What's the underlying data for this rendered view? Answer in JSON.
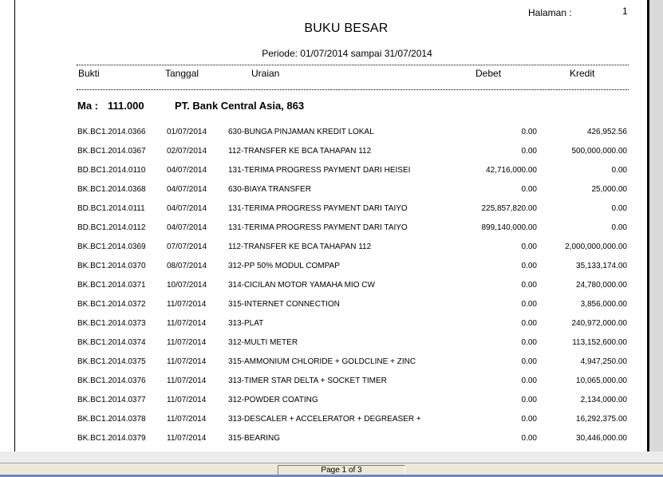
{
  "report": {
    "halaman_label": "Halaman :",
    "halaman_value": "1",
    "title": "BUKU BESAR",
    "periode": "Periode: 01/07/2014 sampai 31/07/2014"
  },
  "columns": {
    "bukti": "Bukti",
    "tanggal": "Tanggal",
    "uraian": "Uraian",
    "debet": "Debet",
    "kredit": "Kredit"
  },
  "account": {
    "prefix": "Ma :",
    "code": "111.000",
    "name": "PT. Bank Central Asia, 863"
  },
  "rows": [
    {
      "bukti": "BK.BC1.2014.0366",
      "tanggal": "01/07/2014",
      "uraian": "630-BUNGA PINJAMAN KREDIT LOKAL",
      "debet": "0.00",
      "kredit": "426,952.56"
    },
    {
      "bukti": "BK.BC1.2014.0367",
      "tanggal": "02/07/2014",
      "uraian": "112-TRANSFER KE BCA TAHAPAN 112",
      "debet": "0.00",
      "kredit": "500,000,000.00"
    },
    {
      "bukti": "BD.BC1.2014.0110",
      "tanggal": "04/07/2014",
      "uraian": "131-TERIMA PROGRESS PAYMENT DARI HEISEI",
      "debet": "42,716,000.00",
      "kredit": "0.00"
    },
    {
      "bukti": "BK.BC1.2014.0368",
      "tanggal": "04/07/2014",
      "uraian": "630-BIAYA TRANSFER",
      "debet": "0.00",
      "kredit": "25,000.00"
    },
    {
      "bukti": "BD.BC1.2014.0111",
      "tanggal": "04/07/2014",
      "uraian": "131-TERIMA PROGRESS PAYMENT DARI TAIYO",
      "debet": "225,857,820.00",
      "kredit": "0.00"
    },
    {
      "bukti": "BD.BC1.2014.0112",
      "tanggal": "04/07/2014",
      "uraian": "131-TERIMA PROGRESS PAYMENT DARI TAIYO",
      "debet": "899,140,000.00",
      "kredit": "0.00"
    },
    {
      "bukti": "BK.BC1.2014.0369",
      "tanggal": "07/07/2014",
      "uraian": "112-TRANSFER KE BCA TAHAPAN 112",
      "debet": "0.00",
      "kredit": "2,000,000,000.00"
    },
    {
      "bukti": "BK.BC1.2014.0370",
      "tanggal": "08/07/2014",
      "uraian": "312-PP 50% MODUL COMPAP",
      "debet": "0.00",
      "kredit": "35,133,174.00"
    },
    {
      "bukti": "BK.BC1.2014.0371",
      "tanggal": "10/07/2014",
      "uraian": "314-CICILAN MOTOR YAMAHA MIO CW",
      "debet": "0.00",
      "kredit": "24,780,000.00"
    },
    {
      "bukti": "BK.BC1.2014.0372",
      "tanggal": "11/07/2014",
      "uraian": "315-INTERNET CONNECTION",
      "debet": "0.00",
      "kredit": "3,856,000.00"
    },
    {
      "bukti": "BK.BC1.2014.0373",
      "tanggal": "11/07/2014",
      "uraian": "313-PLAT",
      "debet": "0.00",
      "kredit": "240,972,000.00"
    },
    {
      "bukti": "BK.BC1.2014.0374",
      "tanggal": "11/07/2014",
      "uraian": "312-MULTI METER",
      "debet": "0.00",
      "kredit": "113,152,600.00"
    },
    {
      "bukti": "BK.BC1.2014.0375",
      "tanggal": "11/07/2014",
      "uraian": "315-AMMONIUM CHLORIDE + GOLDCLINE + ZINC",
      "debet": "0.00",
      "kredit": "4,947,250.00"
    },
    {
      "bukti": "BK.BC1.2014.0376",
      "tanggal": "11/07/2014",
      "uraian": "313-TIMER STAR DELTA + SOCKET TIMER",
      "debet": "0.00",
      "kredit": "10,065,000.00"
    },
    {
      "bukti": "BK.BC1.2014.0377",
      "tanggal": "11/07/2014",
      "uraian": "312-POWDER COATING",
      "debet": "0.00",
      "kredit": "2,134,000.00"
    },
    {
      "bukti": "BK.BC1.2014.0378",
      "tanggal": "11/07/2014",
      "uraian": "313-DESCALER + ACCELERATOR + DEGREASER +",
      "debet": "0.00",
      "kredit": "16,292,375.00"
    },
    {
      "bukti": "BK.BC1.2014.0379",
      "tanggal": "11/07/2014",
      "uraian": "315-BEARING",
      "debet": "0.00",
      "kredit": "30,446,000.00"
    }
  ],
  "statusbar": {
    "page_indicator": "Page 1 of 3"
  }
}
